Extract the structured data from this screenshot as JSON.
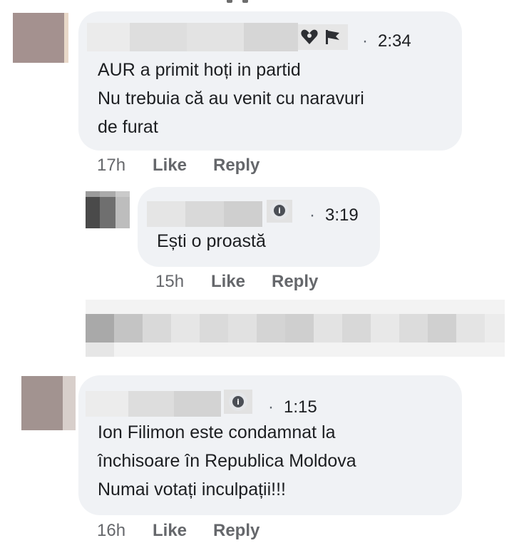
{
  "comments": [
    {
      "time": "2:34",
      "lines": [
        "AUR a primit hoți in partid",
        "Nu trebuia că au venit cu naravuri",
        "de furat"
      ],
      "age": "17h",
      "like": "Like",
      "reply": "Reply",
      "badge_icons": [
        "heart-icon",
        "flag-icon"
      ]
    },
    {
      "time": "3:19",
      "lines": [
        "Ești o proastă"
      ],
      "age": "15h",
      "like": "Like",
      "reply": "Reply",
      "badge_icons": [
        "info-badge-icon"
      ]
    },
    {
      "time": "1:15",
      "lines": [
        "Ion Filimon este condamnat la",
        "închisoare în Republica Moldova",
        "Numai votați inculpații!!!"
      ],
      "age": "16h",
      "like": "Like",
      "reply": "Reply",
      "badge_icons": [
        "info-badge-icon"
      ]
    }
  ],
  "separator_dot": "·",
  "colors": {
    "bubble": "#f0f2f5",
    "text": "#1c1e21",
    "meta": "#65676b"
  }
}
